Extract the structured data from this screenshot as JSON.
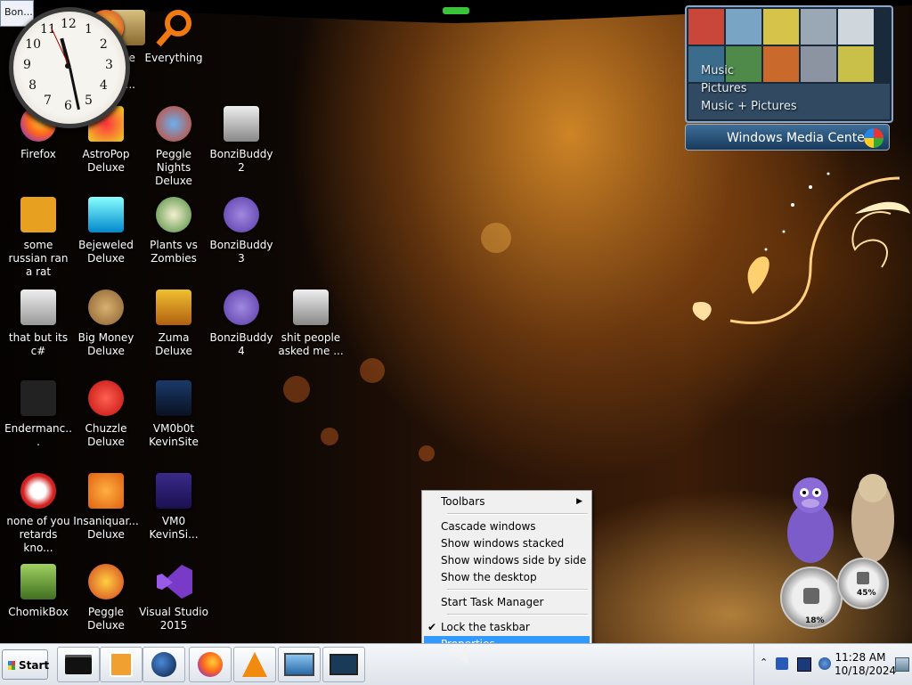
{
  "popup_title": "Bon...",
  "desktop_icons": [
    {
      "label": "ive",
      "icon": "live-icon"
    },
    {
      "label": "Peggle World of Warcraft ...",
      "icon": "peggle-icon"
    },
    {
      "label": "Everything",
      "icon": "search-icon"
    },
    {
      "label": "Firefox",
      "icon": "firefox-icon"
    },
    {
      "label": "AstroPop Deluxe",
      "icon": "astropop-icon"
    },
    {
      "label": "Peggle Nights Deluxe",
      "icon": "peggle-nights-icon"
    },
    {
      "label": "BonziBuddy2",
      "icon": "folder-icon"
    },
    {
      "label": "some russian ran a rat",
      "icon": "de-icon"
    },
    {
      "label": "Bejeweled Deluxe",
      "icon": "gem-icon"
    },
    {
      "label": "Plants vs Zombies",
      "icon": "plant-icon"
    },
    {
      "label": "BonziBuddy3",
      "icon": "bonzi-icon"
    },
    {
      "label": "that but its c#",
      "icon": "windows-stack-icon"
    },
    {
      "label": "Big Money Deluxe",
      "icon": "money-bag-icon"
    },
    {
      "label": "Zuma Deluxe",
      "icon": "zuma-icon"
    },
    {
      "label": "BonziBuddy4",
      "icon": "bonzi-icon"
    },
    {
      "label": "shit people asked me ...",
      "icon": "folder-icon"
    },
    {
      "label": "Endermanc...",
      "icon": "console-icon"
    },
    {
      "label": "Chuzzle Deluxe",
      "icon": "chuzzle-icon"
    },
    {
      "label": "VM0b0t KevinSite",
      "icon": "monitor-icon"
    },
    {
      "label": "none of you retards kno...",
      "icon": "dragon-icon"
    },
    {
      "label": "Insaniquar... Deluxe",
      "icon": "fish-icon"
    },
    {
      "label": "VM0 KevinSi...",
      "icon": "firefox-file-icon"
    },
    {
      "label": "ChomikBox",
      "icon": "chomikbox-icon"
    },
    {
      "label": "Peggle Deluxe",
      "icon": "peggle-icon"
    },
    {
      "label": "Visual Studio 2015",
      "icon": "visual-studio-icon"
    }
  ],
  "clock_numbers": [
    "12",
    "1",
    "2",
    "3",
    "4",
    "5",
    "6",
    "7",
    "8",
    "9",
    "10",
    "11"
  ],
  "media_center": {
    "menu": [
      "Music",
      "Pictures",
      "Music + Pictures"
    ],
    "brand": "Windows Media Center"
  },
  "gauges": {
    "cpu": "18%",
    "memory": "45%"
  },
  "context_menu": {
    "toolbars": "Toolbars",
    "cascade": "Cascade windows",
    "stacked": "Show windows stacked",
    "side_by_side": "Show windows side by side",
    "show_desktop": "Show the desktop",
    "task_manager": "Start Task Manager",
    "lock": "Lock the taskbar",
    "lock_checked": "✔",
    "properties": "Properties"
  },
  "taskbar": {
    "start": "Start",
    "time": "11:28 AM",
    "date": "10/18/2024",
    "pinned": [
      "cmd-icon",
      "media-player-icon",
      "globe-icon",
      "firefox-icon",
      "vlc-icon",
      "display-icon",
      "remote-desktop-icon"
    ]
  },
  "colors": {
    "selection": "#3399ff",
    "menu_bg": "#f0f0f0",
    "taskbar": "#e6eaef"
  }
}
